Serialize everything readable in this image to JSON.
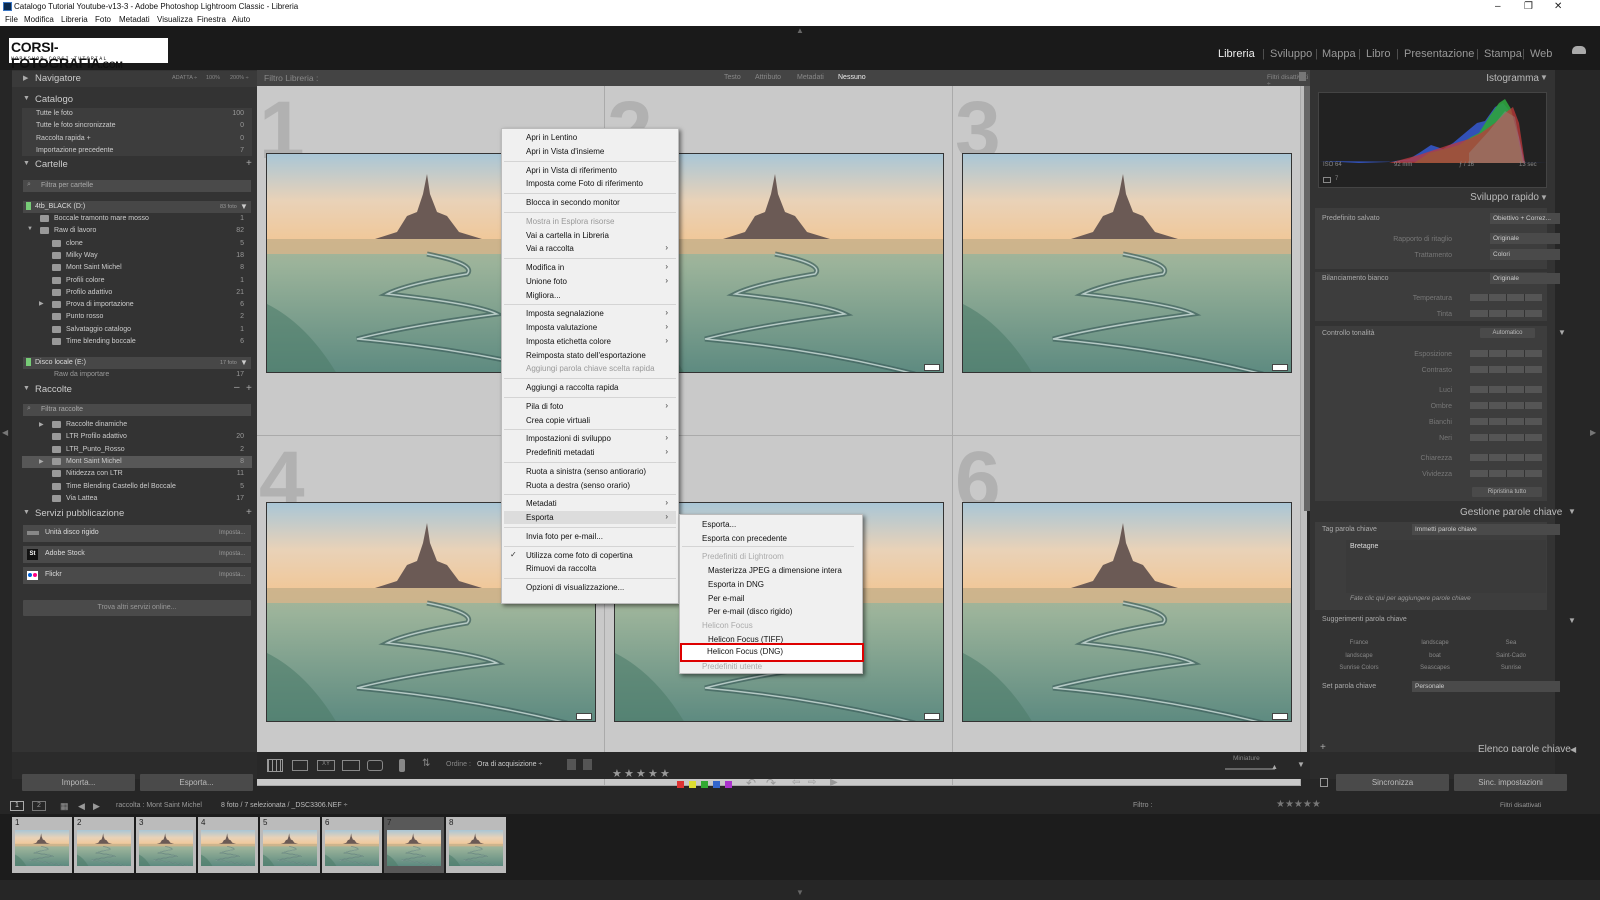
{
  "window": {
    "title": "Catalogo Tutorial Youtube-v13-3 - Adobe Photoshop Lightroom Classic - Libreria"
  },
  "menu": [
    "File",
    "Modifica",
    "Libreria",
    "Foto",
    "Metadati",
    "Visualizza",
    "Finestra",
    "Aiuto"
  ],
  "logo": {
    "main": "CORSI-FOTOGRAFIA",
    "suffix": ".COM",
    "tagline": "WORKSHOP·CORSI·TUTORIAL"
  },
  "modules": [
    "Libreria",
    "Sviluppo",
    "Mappa",
    "Libro",
    "Presentazione",
    "Stampa",
    "Web"
  ],
  "left": {
    "navigator": {
      "title": "Navigatore",
      "zoom": [
        "ADATTA ÷",
        "100%",
        "200% ÷"
      ]
    },
    "catalog": {
      "title": "Catalogo",
      "items": [
        {
          "label": "Tutte le foto",
          "count": "100"
        },
        {
          "label": "Tutte le foto sincronizzate",
          "count": "0"
        },
        {
          "label": "Raccolta rapida +",
          "count": "0"
        },
        {
          "label": "Importazione precedente",
          "count": "7"
        }
      ]
    },
    "folders": {
      "title": "Cartelle",
      "filter": "Filtra per cartelle",
      "drive1": {
        "label": "4tb_BLACK (D:)",
        "info": "83 foto"
      },
      "items": [
        {
          "label": "Boccale tramonto mare mosso",
          "count": "1"
        },
        {
          "label": "Raw di lavoro",
          "count": "82"
        },
        {
          "label": "clone",
          "count": "5"
        },
        {
          "label": "Milky Way",
          "count": "18"
        },
        {
          "label": "Mont Saint Michel",
          "count": "8"
        },
        {
          "label": "Profili colore",
          "count": "1"
        },
        {
          "label": "Profilo adattivo",
          "count": "21"
        },
        {
          "label": "Prova di importazione",
          "count": "6"
        },
        {
          "label": "Punto rosso",
          "count": "2"
        },
        {
          "label": "Salvataggio catalogo",
          "count": "1"
        },
        {
          "label": "Time blending boccale",
          "count": "6"
        }
      ],
      "drive2": {
        "label": "Disco locale (E:)",
        "info": "17 foto"
      },
      "items2": [
        {
          "label": "Raw da importare",
          "count": "17"
        }
      ]
    },
    "collections": {
      "title": "Raccolte",
      "filter": "Filtra raccolte",
      "items": [
        {
          "label": "Raccolte dinamiche",
          "count": ""
        },
        {
          "label": "LTR Profilo adattivo",
          "count": "20"
        },
        {
          "label": "LTR_Punto_Rosso",
          "count": "2"
        },
        {
          "label": "Mont Saint Michel",
          "count": "8"
        },
        {
          "label": "Nitidezza con LTR",
          "count": "11"
        },
        {
          "label": "Time Blending Castello del Boccale",
          "count": "5"
        },
        {
          "label": "Via Lattea",
          "count": "17"
        }
      ]
    },
    "publish": {
      "title": "Servizi pubblicazione",
      "items": [
        {
          "label": "Unità disco rigido",
          "action": "Imposta..."
        },
        {
          "label": "Adobe Stock",
          "action": "Imposta..."
        },
        {
          "label": "Flickr",
          "action": "Imposta..."
        }
      ],
      "more": "Trova altri servizi online..."
    },
    "import_btn": "Importa...",
    "export_btn": "Esporta..."
  },
  "filterbar": {
    "title": "Filtro Libreria :",
    "tabs": [
      "Testo",
      "Attributo",
      "Metadati",
      "Nessuno"
    ],
    "right": "Filtri disattivati ÷"
  },
  "grid": {
    "cells": [
      "1",
      "2",
      "3",
      "4",
      "5",
      "6"
    ]
  },
  "context_menu": {
    "groups": [
      [
        "Apri in Lentino",
        "Apri in Vista d'insieme"
      ],
      [
        "Apri in Vista di riferimento",
        "Imposta come Foto di riferimento"
      ],
      [
        "Blocca in secondo monitor"
      ],
      [
        "Mostra in Esplora risorse",
        "Vai a cartella in Libreria",
        "Vai a raccolta"
      ],
      [
        "Modifica in",
        "Unione foto",
        "Migliora..."
      ],
      [
        "Imposta segnalazione",
        "Imposta valutazione",
        "Imposta etichetta colore",
        "Reimposta stato dell'esportazione",
        "Aggiungi parola chiave scelta rapida"
      ],
      [
        "Aggiungi a raccolta rapida"
      ],
      [
        "Pila di foto",
        "Crea copie virtuali"
      ],
      [
        "Impostazioni di sviluppo",
        "Predefiniti metadati"
      ],
      [
        "Ruota a sinistra (senso antiorario)",
        "Ruota a destra (senso orario)"
      ],
      [
        "Metadati",
        "Esporta"
      ],
      [
        "Invia foto per e-mail..."
      ],
      [
        "Utilizza come foto di copertina",
        "Rimuovi da raccolta"
      ],
      [
        "Opzioni di visualizzazione..."
      ]
    ]
  },
  "submenu": {
    "items": [
      "Esporta...",
      "Esporta con precedente"
    ],
    "section1": "Predefiniti di Lightroom",
    "lr_items": [
      "Masterizza JPEG a dimensione intera",
      "Esporta in DNG",
      "Per e-mail",
      "Per e-mail (disco rigido)"
    ],
    "section2": "Helicon Focus",
    "hf_items": [
      "Helicon Focus (TIFF)",
      "Helicon Focus (DNG)"
    ],
    "section3": "Predefiniti utente"
  },
  "right": {
    "histogram": {
      "title": "Istogramma",
      "info": [
        "ISO 64",
        "92 mm",
        "ƒ / 16",
        "13 sec"
      ]
    },
    "quick_develop": {
      "title": "Sviluppo rapido",
      "preset_label": "Predefinito salvato",
      "preset": "Obiettivo + Correz...",
      "crop_label": "Rapporto di ritaglio",
      "crop": "Originale",
      "treat_label": "Trattamento",
      "treat": "Colori",
      "wb_label": "Bilanciamento bianco",
      "wb": "Originale",
      "temp": "Temperatura",
      "tint": "Tinta",
      "tone_label": "Controllo tonalità",
      "auto": "Automatico",
      "sliders": [
        "Esposizione",
        "Contrasto",
        "Luci",
        "Ombre",
        "Bianchi",
        "Neri",
        "Chiarezza",
        "Vividezza"
      ],
      "reset": "Ripristina tutto"
    },
    "keywording": {
      "title": "Gestione parole chiave",
      "tag_label": "Tag parola chiave",
      "tag_value": "Immetti parole chiave",
      "keyword": "Bretagne",
      "hint": "Fate clic qui per aggiungere parole chiave",
      "suggest_title": "Suggerimenti parola chiave",
      "suggestions": [
        "France",
        "landscape",
        "Sea",
        "landscape",
        "boat",
        "Saint-Cado",
        "Sunrise Colors",
        "Seascapes",
        "Sunrise"
      ],
      "set_label": "Set parola chiave",
      "set_value": "Personale"
    },
    "keyword_list": "Elenco parole chiave",
    "sync": "Sincronizza",
    "sync_settings": "Sinc. impostazioni"
  },
  "toolbar": {
    "order": "Ordine :",
    "order_value": "Ora di acquisizione ÷",
    "thumb": "Miniature"
  },
  "filmstrip": {
    "source": "raccolta : Mont Saint Michel",
    "count": "8 foto / 7 selezionata / _DSC3306.NEF ÷",
    "filter": "Filtro :",
    "filter_state": "Filtri disattivati",
    "thumbs": [
      "1",
      "2",
      "3",
      "4",
      "5",
      "6",
      "7",
      "8"
    ],
    "pages": [
      "1",
      "2"
    ]
  },
  "colors": {
    "accent": "#d00000",
    "panel": "#333333",
    "grid": "#bdbdbd"
  }
}
